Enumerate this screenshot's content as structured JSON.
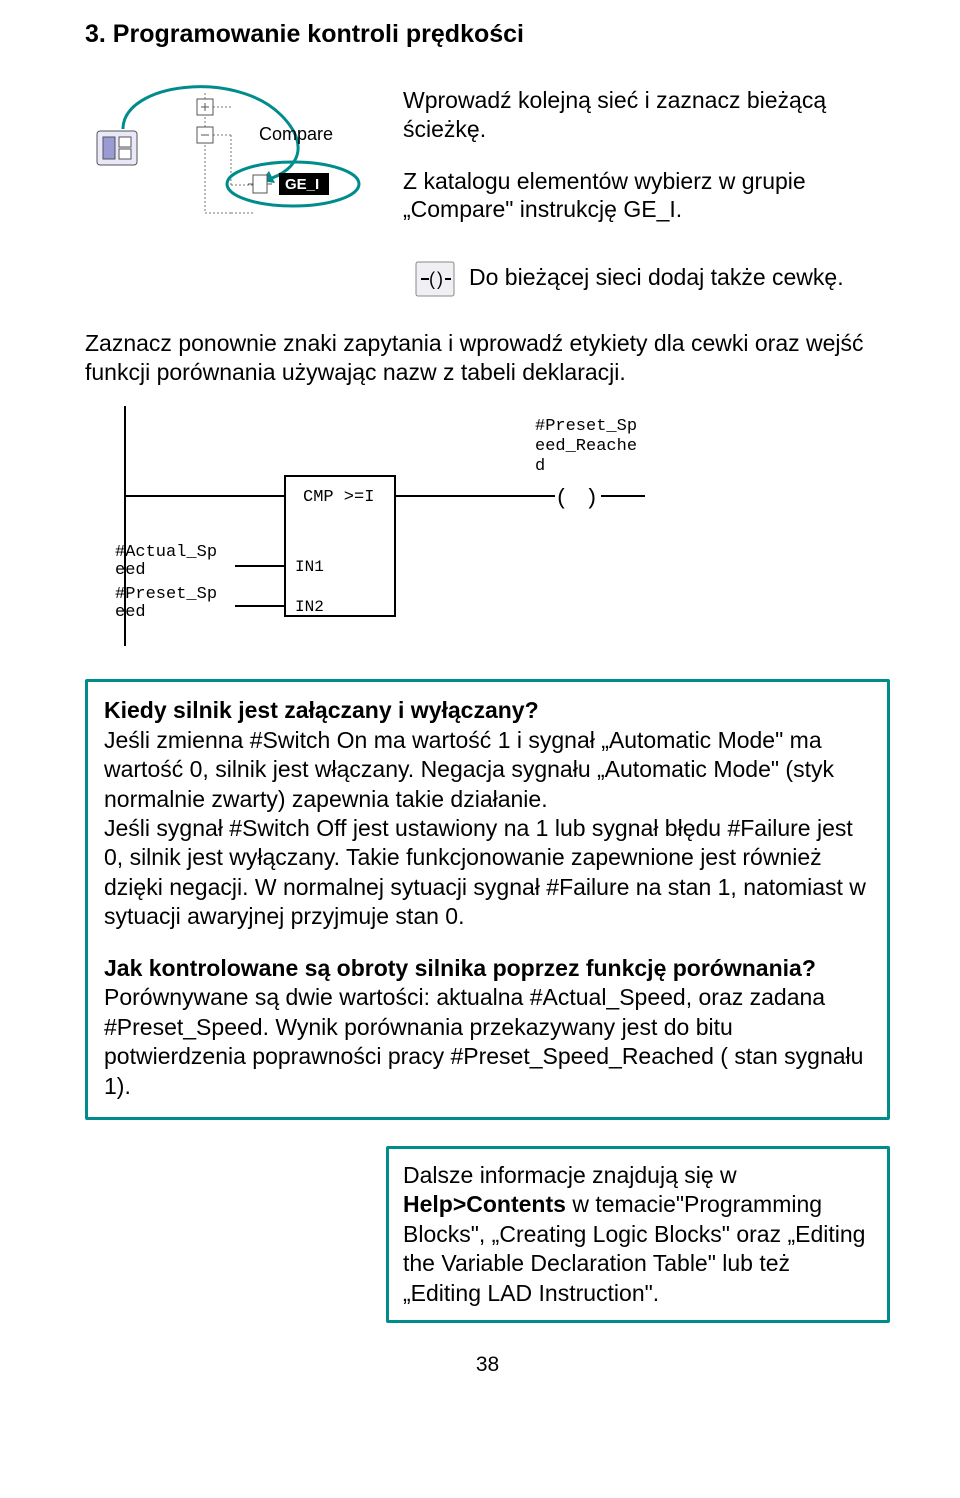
{
  "title": "3. Programowanie kontroli prędkości",
  "block1": {
    "intro1": "Wprowadź kolejną sieć i zaznacz bieżącą ścieżkę.",
    "intro2": "Z katalogu elementów wybierz w grupie „Compare\" instrukcję GE_I.",
    "tree": {
      "group": "Compare",
      "item": "GE_I"
    }
  },
  "block2": {
    "line1": "Do bieżącej sieci dodaj także cewkę."
  },
  "para3": "Zaznacz ponownie znaki zapytania i wprowadź etykiety dla cewki oraz wejść funkcji porównania używając nazw z tabeli deklaracji.",
  "ladder": {
    "coil_label": "#Preset_Speed_Reached",
    "cmp_label": "CMP >=I",
    "in1_label": "IN1",
    "in2_label": "IN2",
    "actual": "#Actual_Speed",
    "preset": "#Preset_Speed"
  },
  "frame": {
    "q1": "Kiedy silnik jest załączany i wyłączany?",
    "p1": "Jeśli zmienna #Switch On ma wartość 1 i sygnał „Automatic Mode\" ma wartość 0, silnik jest włączany. Negacja sygnału „Automatic Mode\" (styk normalnie zwarty) zapewnia takie działanie.",
    "p1b": "Jeśli sygnał #Switch Off jest ustawiony na 1 lub sygnał błędu #Failure jest 0, silnik jest wyłączany. Takie funkcjonowanie zapewnione jest również dzięki negacji. W normalnej sytuacji sygnał #Failure na stan 1, natomiast w sytuacji awaryjnej przyjmuje stan 0.",
    "q2": " Jak kontrolowane są obroty silnika poprzez funkcję porównania?",
    "p2": "Porównywane są dwie wartości: aktualna #Actual_Speed, oraz zadana #Preset_Speed. Wynik porównania przekazywany jest do bitu potwierdzenia poprawności pracy #Preset_Speed_Reached ( stan sygnału 1)."
  },
  "callout": {
    "a": "Dalsze informacje znajdują się w ",
    "b": "Help>Contents",
    "c": " w temacie\"Programming Blocks\", „Creating Logic Blocks\" oraz „Editing the Variable Declaration Table\" lub też „Editing LAD Instruction\"."
  },
  "pagenum": "38",
  "icons": {
    "overview": "overview-icon",
    "plus": "plus-icon",
    "minus": "minus-icon",
    "box": "box-icon",
    "coil": "coil-icon"
  }
}
